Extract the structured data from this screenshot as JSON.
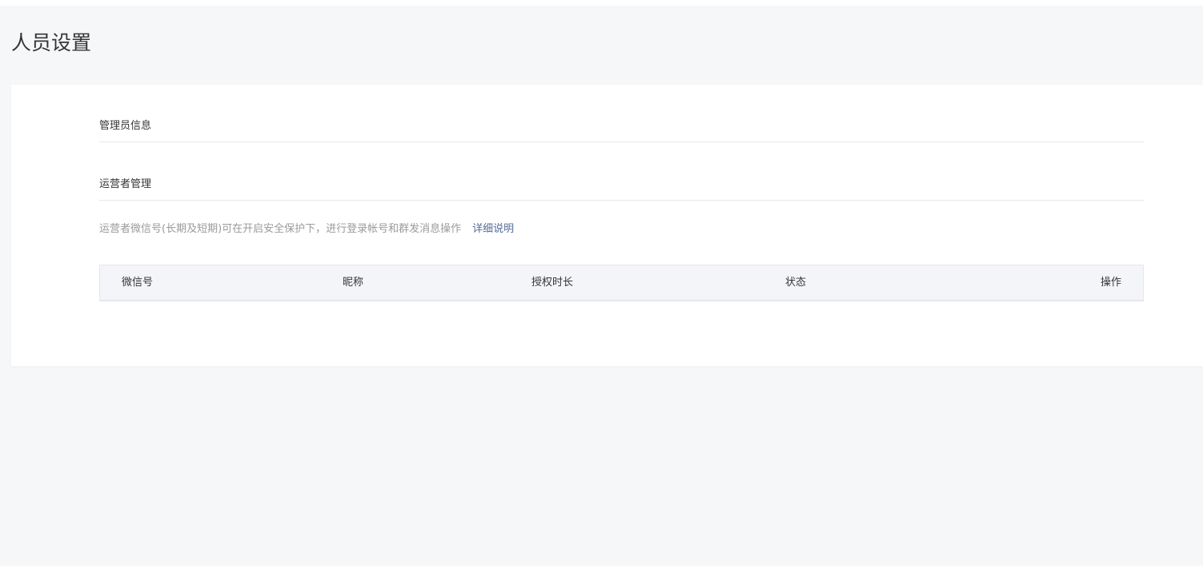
{
  "page": {
    "title": "人员设置"
  },
  "admin_section": {
    "title": "管理员信息"
  },
  "operator_section": {
    "title": "运营者管理",
    "tip": "运营者微信号(长期及短期)可在开启安全保护下，进行登录帐号和群发消息操作",
    "tip_link": "详细说明"
  },
  "table": {
    "columns": [
      "微信号",
      "昵称",
      "授权时长",
      "状态",
      "操作"
    ],
    "rows": []
  },
  "colors": {
    "background": "#f6f7f9",
    "panel": "#ffffff",
    "link": "#576b95",
    "tip_text": "#9a9a9a",
    "header_bg": "#f4f5f9"
  }
}
